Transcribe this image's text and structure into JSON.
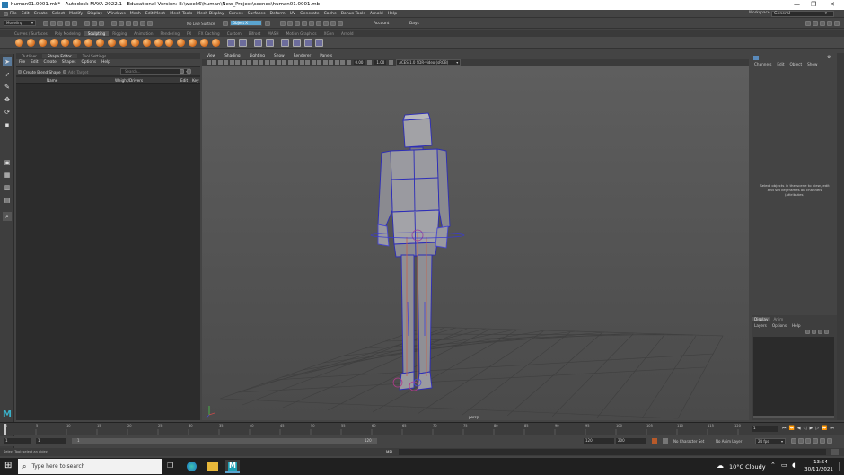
{
  "title": "human01.0001.mb* - Autodesk MAYA 2022.1 - Educational Version: E:\\week6\\human\\New_Project\\scenes\\human01.0001.mb",
  "menu": [
    "File",
    "Edit",
    "Create",
    "Select",
    "Modify",
    "Display",
    "Windows",
    "Mesh",
    "Edit Mesh",
    "Mesh Tools",
    "Mesh Display",
    "Curves",
    "Surfaces",
    "Deform",
    "UV",
    "Generate",
    "Cache",
    "Bonus Tools",
    "Arnold",
    "Help"
  ],
  "workspace": {
    "label": "Workspace :",
    "value": "General"
  },
  "status": {
    "menuset": "Modeling",
    "live_surface": "No Live Surface",
    "symmetry": "Object X",
    "account": "Account",
    "days": "Days"
  },
  "shelf_tabs": [
    "Curves / Surfaces",
    "Poly Modeling",
    "Sculpting",
    "Rigging",
    "Animation",
    "Rendering",
    "FX",
    "FX Caching",
    "Custom",
    "Bifrost",
    "MASH",
    "Motion Graphics",
    "XGen",
    "Arnold"
  ],
  "shelf_active": "Sculpting",
  "left_panel": {
    "tabs": [
      "Outliner",
      "Shape Editor",
      "Tool Settings"
    ],
    "active_tab": "Shape Editor",
    "menu": [
      "File",
      "Edit",
      "Create",
      "Shapes",
      "Options",
      "Help"
    ],
    "create_button": "Create Blend Shape",
    "add_target": "Add Target",
    "search_placeholder": "Search...",
    "columns": {
      "name": "Name",
      "weight": "Weight/Drivers",
      "edit": "Edit",
      "key": "Key"
    }
  },
  "viewport": {
    "menu": [
      "View",
      "Shading",
      "Lighting",
      "Show",
      "Renderer",
      "Panels"
    ],
    "symmetry_label": "Symmetry: Object X",
    "camera_label": "persp",
    "gamma": "0.00",
    "exposure": "1.00",
    "colorspace": "ACES 1.0 SDR-video (sRGB)"
  },
  "channel_box": {
    "menu": [
      "Channels",
      "Edit",
      "Object",
      "Show"
    ],
    "hint": "Select objects in the scene to view, edit and set keyframes on channels (attributes)"
  },
  "layers": {
    "tabs": [
      "Display",
      "Anim"
    ],
    "menu": [
      "Layers",
      "Options",
      "Help"
    ]
  },
  "time": {
    "ticks": [
      "1",
      "5",
      "10",
      "15",
      "20",
      "25",
      "30",
      "35",
      "40",
      "45",
      "50",
      "55",
      "60",
      "65",
      "70",
      "75",
      "80",
      "85",
      "90",
      "95",
      "100",
      "105",
      "110",
      "115",
      "120"
    ],
    "current": "1",
    "range_start": "1",
    "range_start2": "1",
    "range_inner": "1",
    "range_end_inner": "120",
    "range_end": "120",
    "anim_end": "200",
    "character_set": "No Character Set",
    "anim_layer": "No Anim Layer",
    "fps": "24 fps"
  },
  "mel": {
    "label": "MEL",
    "help": "Select Tool: select an object"
  },
  "taskbar": {
    "search": "Type here to search",
    "weather": "10°C  Cloudy",
    "time": "13:54",
    "date": "30/11/2021"
  },
  "colors": {
    "accent": "#5ba4cf",
    "wire": "#3a3acc",
    "selection": "#cc3a3a"
  }
}
